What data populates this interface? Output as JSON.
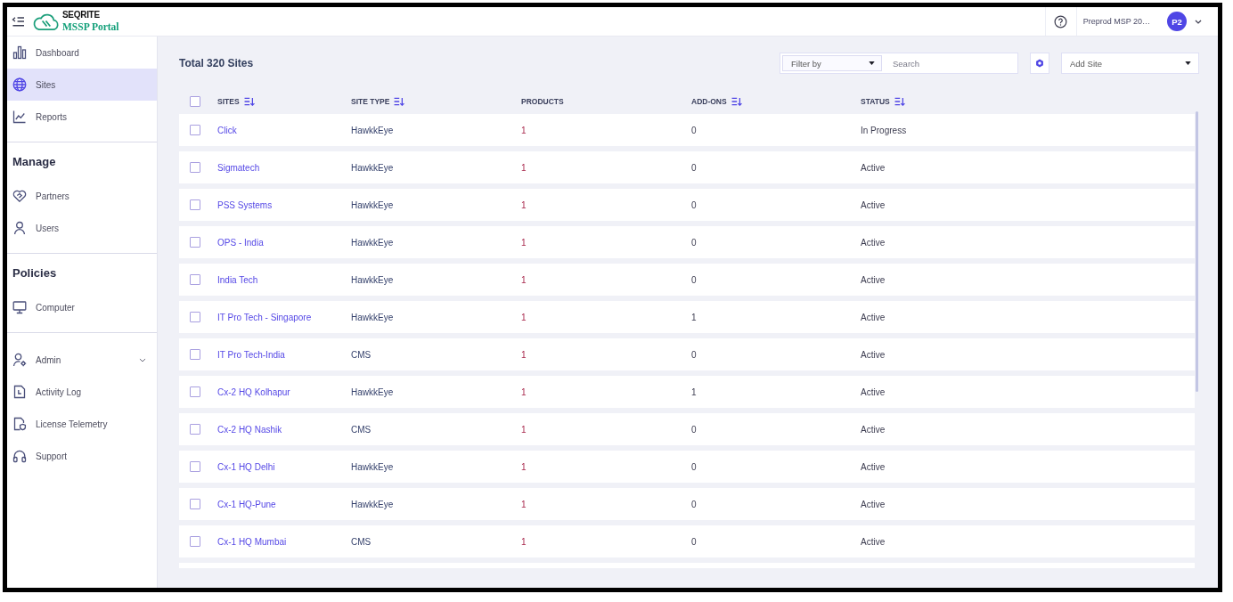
{
  "header": {
    "brand": "SEQRITE",
    "product": "MSSP Portal",
    "account": "Preprod MSP 20…",
    "avatar": "P2"
  },
  "sidebar": {
    "sections": [
      {
        "items": [
          {
            "label": "Dashboard",
            "kind": "link",
            "selected": false
          },
          {
            "label": "Sites",
            "kind": "link",
            "selected": true
          },
          {
            "label": "Reports",
            "kind": "link",
            "selected": false
          }
        ]
      },
      {
        "heading": "Manage",
        "items": [
          {
            "label": "Partners",
            "kind": "link",
            "selected": false
          },
          {
            "label": "Users",
            "kind": "link",
            "selected": false
          }
        ]
      },
      {
        "heading": "Policies",
        "items": [
          {
            "label": "Computer",
            "kind": "link",
            "selected": false
          }
        ]
      },
      {
        "items": [
          {
            "label": "Admin",
            "kind": "group",
            "selected": false,
            "expanded": false
          },
          {
            "label": "Activity Log",
            "kind": "link",
            "selected": false
          },
          {
            "label": "License Telemetry",
            "kind": "link",
            "selected": false
          },
          {
            "label": "Support",
            "kind": "link",
            "selected": false
          }
        ]
      }
    ]
  },
  "toolbar": {
    "title": "Total 320 Sites",
    "filter": "Filter by",
    "search": {
      "placeholder": "Search"
    },
    "add": "Add Site"
  },
  "table": {
    "all_checked": false,
    "columns": [
      {
        "label": "SITES",
        "sortable": true
      },
      {
        "label": "SITE TYPE",
        "sortable": true
      },
      {
        "label": "PRODUCTS",
        "sortable": false
      },
      {
        "label": "ADD-ONS",
        "sortable": true
      },
      {
        "label": "STATUS",
        "sortable": true
      }
    ],
    "rows": [
      {
        "checked": false,
        "site": "Click",
        "site_type": "HawkkEye",
        "products": "1",
        "add_ons": "0",
        "status": "In Progress"
      },
      {
        "checked": false,
        "site": "Sigmatech",
        "site_type": "HawkkEye",
        "products": "1",
        "add_ons": "0",
        "status": "Active"
      },
      {
        "checked": false,
        "site": "PSS Systems",
        "site_type": "HawkkEye",
        "products": "1",
        "add_ons": "0",
        "status": "Active"
      },
      {
        "checked": false,
        "site": "OPS - India",
        "site_type": "HawkkEye",
        "products": "1",
        "add_ons": "0",
        "status": "Active"
      },
      {
        "checked": false,
        "site": "India Tech",
        "site_type": "HawkkEye",
        "products": "1",
        "add_ons": "0",
        "status": "Active"
      },
      {
        "checked": false,
        "site": "IT Pro Tech - Singapore",
        "site_type": "HawkkEye",
        "products": "1",
        "add_ons": "1",
        "status": "Active"
      },
      {
        "checked": false,
        "site": "IT Pro Tech-India",
        "site_type": "CMS",
        "products": "1",
        "add_ons": "0",
        "status": "Active"
      },
      {
        "checked": false,
        "site": "Cx-2 HQ Kolhapur",
        "site_type": "HawkkEye",
        "products": "1",
        "add_ons": "1",
        "status": "Active"
      },
      {
        "checked": false,
        "site": "Cx-2 HQ Nashik",
        "site_type": "CMS",
        "products": "1",
        "add_ons": "0",
        "status": "Active"
      },
      {
        "checked": false,
        "site": "Cx-1 HQ Delhi",
        "site_type": "HawkkEye",
        "products": "1",
        "add_ons": "0",
        "status": "Active"
      },
      {
        "checked": false,
        "site": "Cx-1 HQ-Pune",
        "site_type": "HawkkEye",
        "products": "1",
        "add_ons": "0",
        "status": "Active"
      },
      {
        "checked": false,
        "site": "Cx-1 HQ Mumbai",
        "site_type": "CMS",
        "products": "1",
        "add_ons": "0",
        "status": "Active"
      }
    ]
  }
}
